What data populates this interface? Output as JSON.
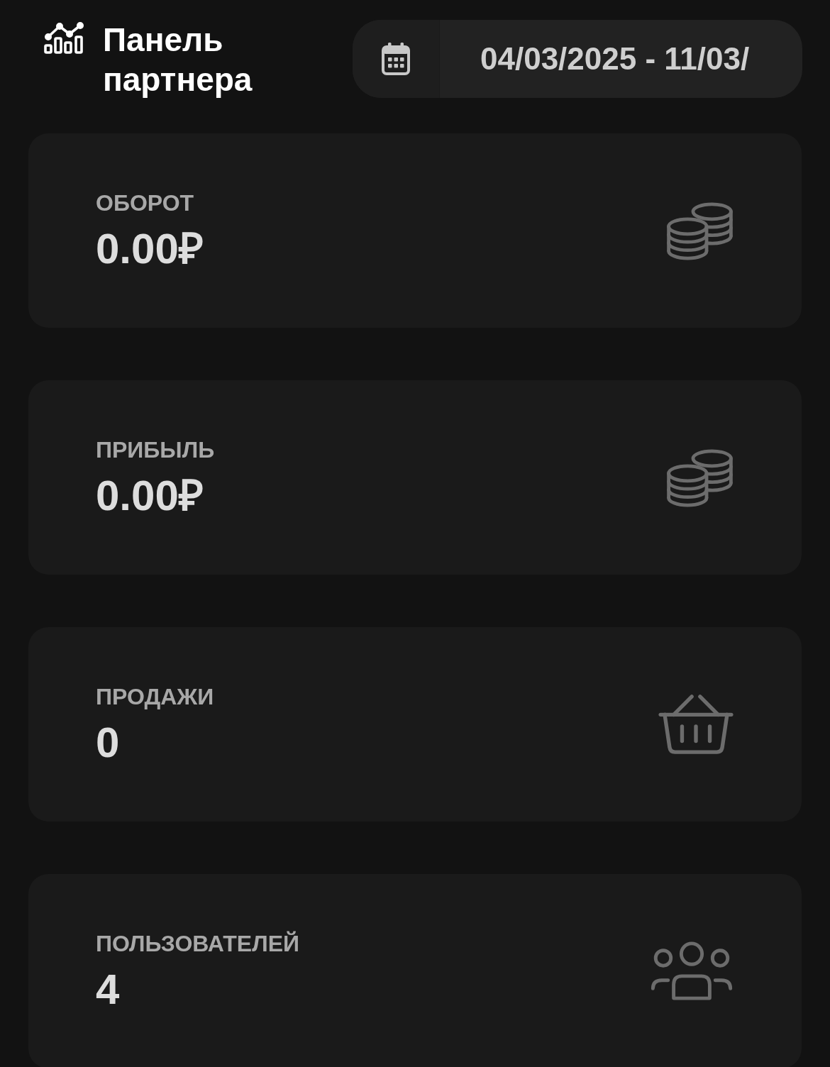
{
  "header": {
    "title": "Панель партнера",
    "date_range": {
      "value": "04/03/2025 - 11/03/"
    }
  },
  "stats": [
    {
      "label": "ОБОРОТ",
      "value": "0.00₽",
      "kind": "coins"
    },
    {
      "label": "ПРИБЫЛЬ",
      "value": "0.00₽",
      "kind": "coins"
    },
    {
      "label": "ПРОДАЖИ",
      "value": "0",
      "kind": "basket"
    },
    {
      "label": "ПОЛЬЗОВАТЕЛЕЙ",
      "value": "4",
      "kind": "users"
    }
  ]
}
